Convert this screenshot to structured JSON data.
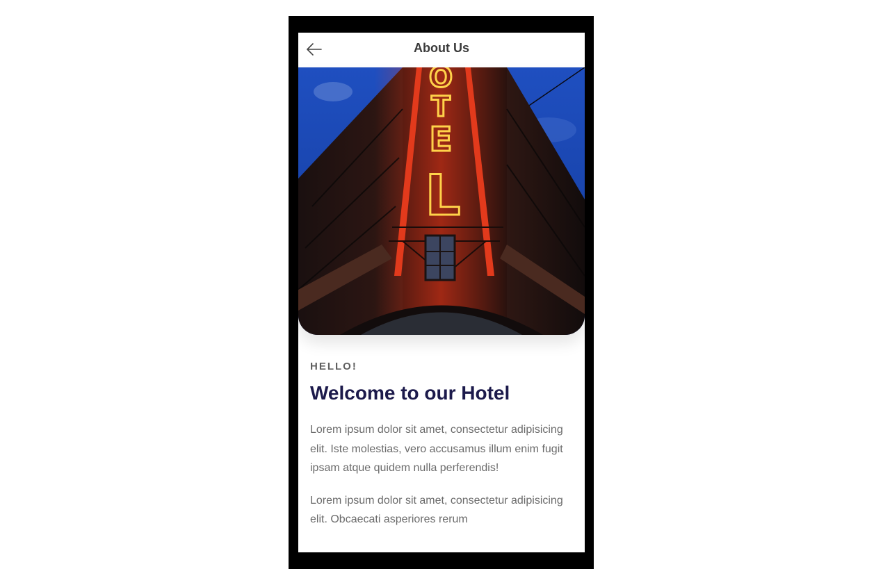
{
  "header": {
    "title": "About Us",
    "back_icon": "arrow-left-icon"
  },
  "hero": {
    "image": "hotel-neon-sign-photo",
    "sign_letters": [
      "O",
      "T",
      "E",
      "L"
    ]
  },
  "section": {
    "eyebrow": "HELLO!",
    "heading": "Welcome to our Hotel",
    "paragraphs": [
      "Lorem ipsum dolor sit amet, consectetur adipisicing elit. Iste molestias, vero accusamus illum enim fugit ipsam atque quidem nulla perferendis!",
      "Lorem ipsum dolor sit amet, consectetur adipisicing elit. Obcaecati asperiores rerum"
    ]
  },
  "colors": {
    "heading": "#1c1a4b",
    "eyebrow": "#5f5f5f",
    "body_text": "#6b6b6b",
    "frame": "#000000"
  }
}
